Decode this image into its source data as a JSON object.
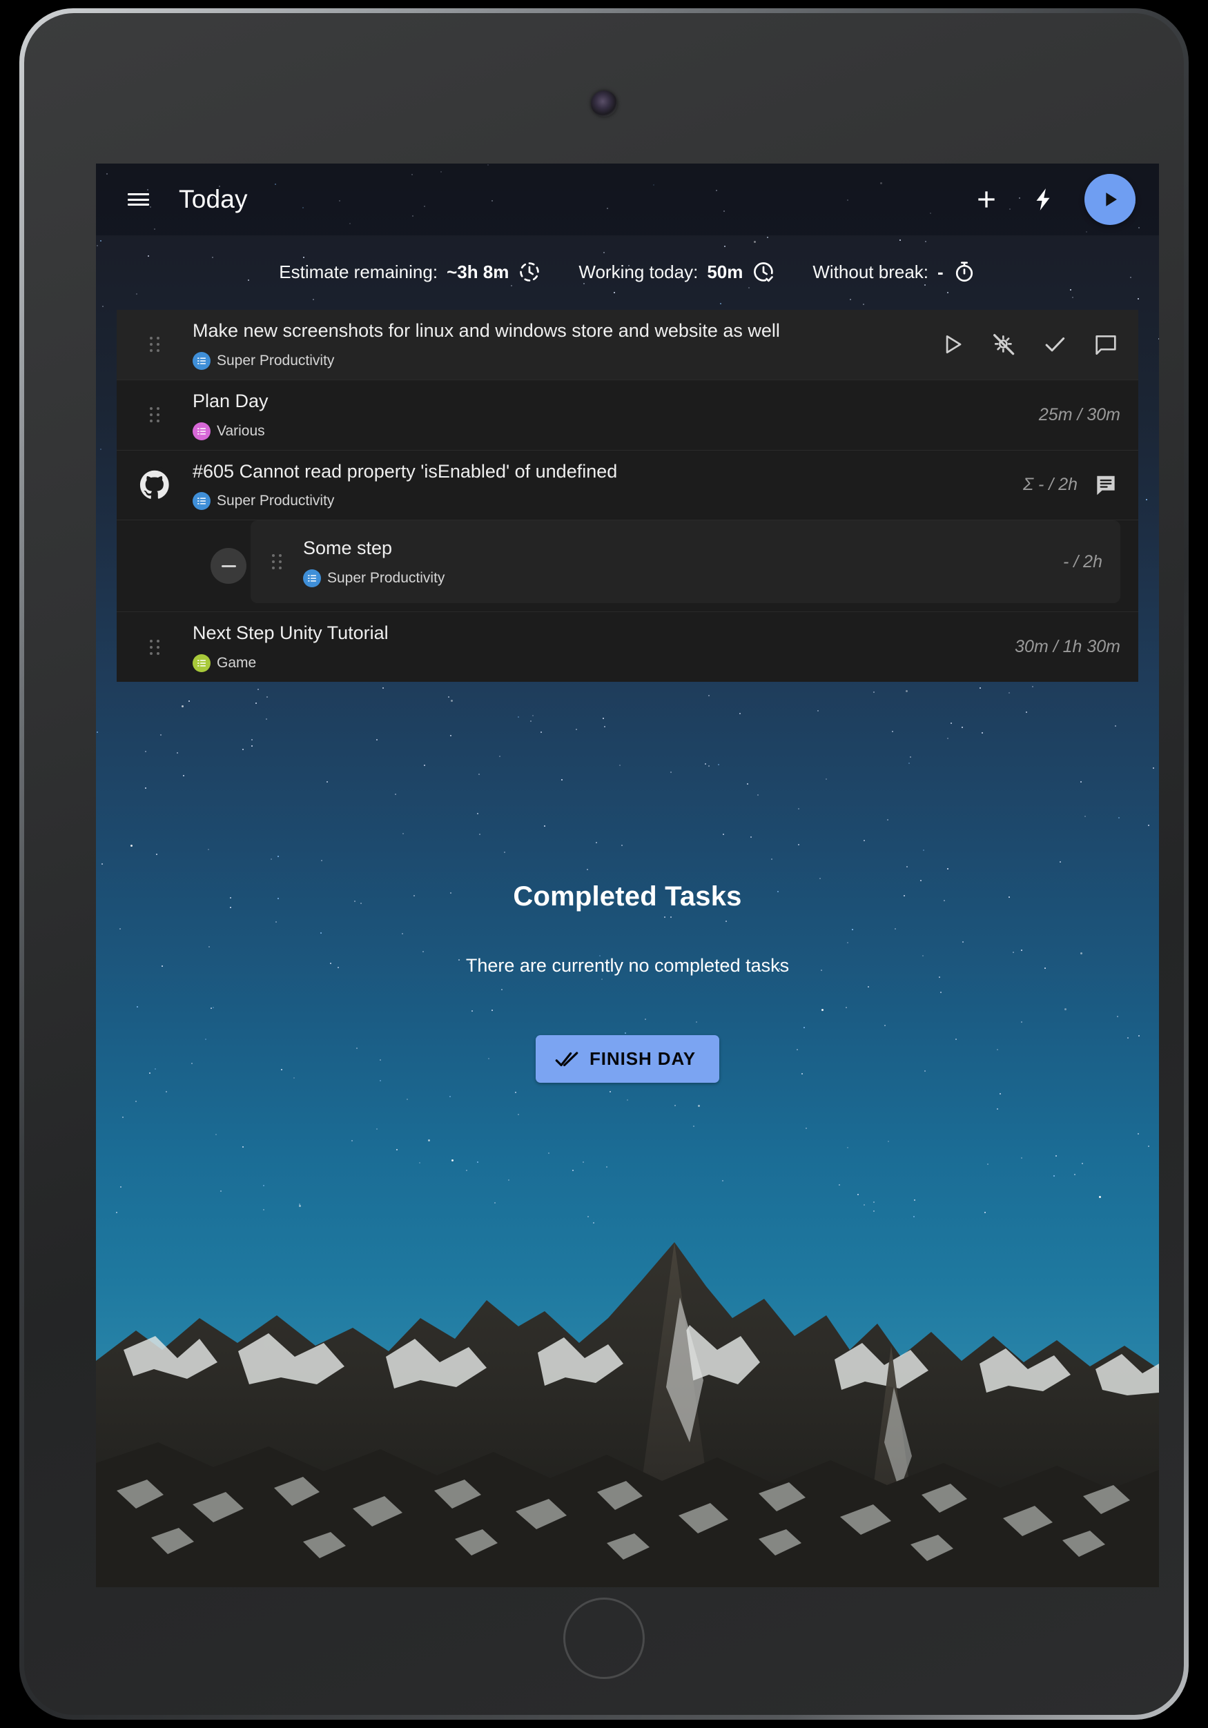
{
  "app": {
    "title": "Today",
    "menu_icon": "hamburger-menu-icon",
    "add_icon": "plus-icon",
    "flash_icon": "lightning-bolt-icon",
    "play_icon": "play-icon",
    "accent_color": "#6f9ef2",
    "button_color": "#7ba4f2"
  },
  "stats": [
    {
      "label": "Estimate remaining:",
      "value": "~3h 8m",
      "icon": "clock-dashed-icon"
    },
    {
      "label": "Working today:",
      "value": "50m",
      "icon": "clock-check-icon"
    },
    {
      "label": "Without break:",
      "value": "-",
      "icon": "timer-icon"
    }
  ],
  "tasks": [
    {
      "title": "Make new screenshots for linux and windows store and website as well",
      "project": "Super Productivity",
      "project_color": "#3f8fd8",
      "time": "",
      "actions": [
        "play-icon",
        "magic-wand-off-icon",
        "check-icon",
        "comment-icon"
      ]
    },
    {
      "title": "Plan Day",
      "project": "Various",
      "project_color": "#d768d7",
      "time": "25m / 30m",
      "actions": []
    },
    {
      "title": "#605 Cannot read property 'isEnabled' of undefined",
      "project": "Super Productivity",
      "project_color": "#3f8fd8",
      "time": "Σ - / 2h",
      "issue_icon": "github-icon",
      "actions": [
        "notes-icon"
      ]
    },
    {
      "title": "Some step",
      "project": "Super Productivity",
      "project_color": "#3f8fd8",
      "time": "- / 2h",
      "is_subtask": true,
      "collapse_icon": "minus-circle-icon"
    },
    {
      "title": "Next Step Unity Tutorial",
      "project": "Game",
      "project_color": "#a8c93a",
      "time": "30m / 1h 30m",
      "actions": []
    }
  ],
  "completed": {
    "title": "Completed Tasks",
    "empty_message": "There are currently no completed tasks",
    "finish_day_label": "FINISH DAY",
    "finish_day_icon": "double-check-icon"
  }
}
